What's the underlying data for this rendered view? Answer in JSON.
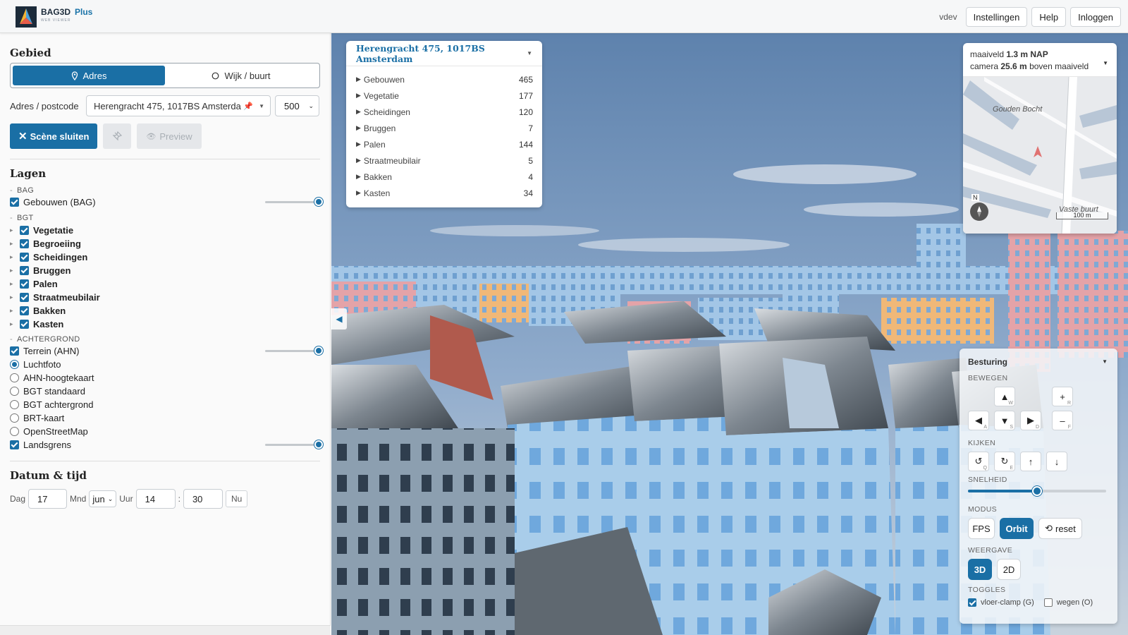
{
  "app": {
    "logo_title": "BAG3D",
    "logo_plus": "Plus",
    "logo_sub": "WEB VIEWER",
    "version": "vdev",
    "nav": {
      "settings": "Instellingen",
      "help": "Help",
      "login": "Inloggen"
    }
  },
  "area": {
    "heading": "Gebied",
    "tab_address": "Adres",
    "tab_district": "Wijk / buurt",
    "address_label": "Adres / postcode",
    "address_value": "Herengracht 475, 1017BS Amsterda",
    "radius_value": "500",
    "close_scene": "Scène sluiten",
    "preview": "Preview"
  },
  "layers": {
    "heading": "Lagen",
    "group_bag": "BAG",
    "bag_buildings": "Gebouwen (BAG)",
    "group_bgt": "BGT",
    "bgt_items": [
      "Vegetatie",
      "Begroeiing",
      "Scheidingen",
      "Bruggen",
      "Palen",
      "Straatmeubilair",
      "Bakken",
      "Kasten"
    ],
    "group_background": "ACHTERGROND",
    "terrain": "Terrein (AHN)",
    "bg_options": [
      "Luchtfoto",
      "AHN-hoogtekaart",
      "BGT standaard",
      "BGT achtergrond",
      "BRT-kaart",
      "OpenStreetMap"
    ],
    "bg_selected": "Luchtfoto",
    "border": "Landsgrens",
    "opacity_bag": 1.0,
    "opacity_terrain": 1.0,
    "opacity_border": 1.0
  },
  "datetime": {
    "heading": "Datum & tijd",
    "day_label": "Dag",
    "day": "17",
    "month_label": "Mnd",
    "month": "jun",
    "hour_label": "Uur",
    "hour": "14",
    "sep": ":",
    "minute": "30",
    "now": "Nu"
  },
  "stats": {
    "title": "Herengracht 475, 1017BS Amsterdam",
    "items": [
      {
        "label": "Gebouwen",
        "value": "465"
      },
      {
        "label": "Vegetatie",
        "value": "177"
      },
      {
        "label": "Scheidingen",
        "value": "120"
      },
      {
        "label": "Bruggen",
        "value": "7"
      },
      {
        "label": "Palen",
        "value": "144"
      },
      {
        "label": "Straatmeubilair",
        "value": "5"
      },
      {
        "label": "Bakken",
        "value": "4"
      },
      {
        "label": "Kasten",
        "value": "34"
      }
    ]
  },
  "minimap": {
    "ground_label": "maaiveld",
    "ground_value": "1.3 m NAP",
    "camera_label": "camera",
    "camera_value": "25.6 m",
    "camera_suffix": "boven maaiveld",
    "place_1": "Gouden Bocht",
    "place_2": "Vaste buurt",
    "north": "N",
    "scale": "100 m"
  },
  "controls": {
    "title": "Besturing",
    "move_heading": "BEWEGEN",
    "look_heading": "KIJKEN",
    "speed_heading": "SNELHEID",
    "speed": 0.5,
    "mode_heading": "MODUS",
    "mode_fps": "FPS",
    "mode_orbit": "Orbit",
    "reset": "reset",
    "view_heading": "WEERGAVE",
    "view_3d": "3D",
    "view_2d": "2D",
    "toggles_heading": "TOGGLES",
    "toggle_floor": "vloer-clamp (G)",
    "toggle_roads": "wegen (O)",
    "keys": {
      "up": "W",
      "left": "A",
      "down": "S",
      "right": "D",
      "zoom_in": "R",
      "zoom_out": "F",
      "rot_left": "Q",
      "rot_right": "E"
    }
  },
  "colors": {
    "accent": "#1a6fa5",
    "sky": "#6e8fb5",
    "facade_light": "#a9cdea",
    "facade_dark": "#7fb0dc",
    "roof": "#7f8890"
  }
}
